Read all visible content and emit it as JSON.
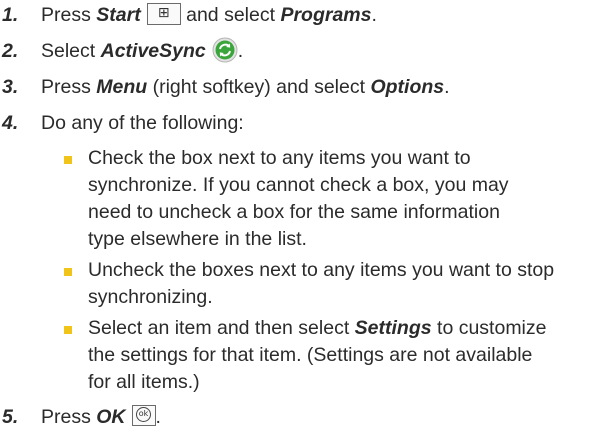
{
  "steps": [
    {
      "num": "1.",
      "pre": "Press ",
      "em1": "Start",
      "key1": "⊞",
      "mid": " and select ",
      "em2": "Programs",
      "post": "."
    },
    {
      "num": "2.",
      "pre": "Select ",
      "em1": "ActiveSync",
      "post": "."
    },
    {
      "num": "3.",
      "pre": "Press ",
      "em1": "Menu",
      "mid": " (right softkey) and select ",
      "em2": "Options",
      "post": "."
    },
    {
      "num": "4.",
      "text": "Do any of the following:"
    },
    {
      "num": "5.",
      "pre": "Press ",
      "em1": "OK",
      "key1": "ok",
      "post": "."
    }
  ],
  "subitems": [
    {
      "lines": [
        "Check the box next to any items you want to",
        "synchronize. If you cannot check a box, you may",
        "need to uncheck a box for the same information",
        "type elsewhere in the list."
      ]
    },
    {
      "lines": [
        "Uncheck the boxes next to any items you want to stop",
        "synchronizing."
      ]
    },
    {
      "line1_pre": "Select an item and then select ",
      "line1_em": "Settings",
      "line1_post": " to customize",
      "lines_rest": [
        "the settings for that item. (Settings are not available",
        "for all items.)"
      ]
    }
  ],
  "colors": {
    "bullet": "#f0c419",
    "text": "#2b2b2b",
    "sync_green": "#3aa53a"
  }
}
